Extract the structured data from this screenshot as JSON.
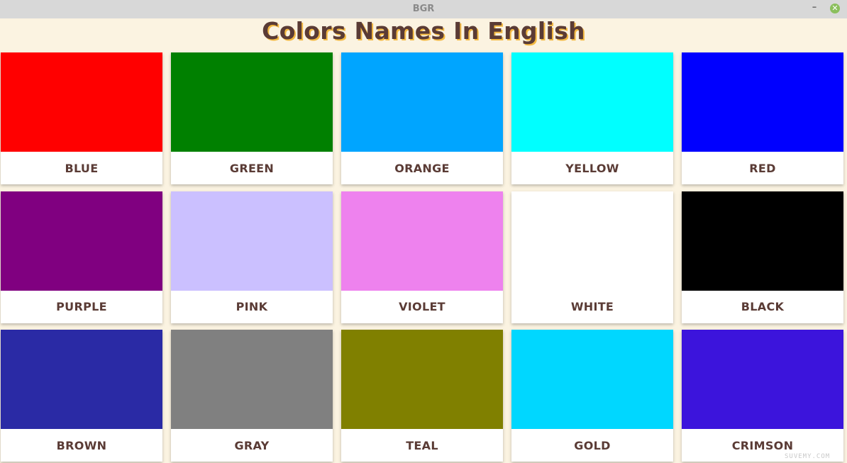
{
  "window": {
    "title": "BGR",
    "minimize_glyph": "–",
    "close_glyph": "✕"
  },
  "page": {
    "heading": "Colors Names In English"
  },
  "colors": [
    {
      "label": "BLUE",
      "swatch": "#ff0000"
    },
    {
      "label": "GREEN",
      "swatch": "#008000"
    },
    {
      "label": "ORANGE",
      "swatch": "#00a5ff"
    },
    {
      "label": "YELLOW",
      "swatch": "#00ffff"
    },
    {
      "label": "RED",
      "swatch": "#0000ff"
    },
    {
      "label": "PURPLE",
      "swatch": "#800080"
    },
    {
      "label": "PINK",
      "swatch": "#cbc0ff"
    },
    {
      "label": "VIOLET",
      "swatch": "#ee82ee"
    },
    {
      "label": "WHITE",
      "swatch": "#ffffff"
    },
    {
      "label": "BLACK",
      "swatch": "#000000"
    },
    {
      "label": "BROWN",
      "swatch": "#2a2aa5"
    },
    {
      "label": "GRAY",
      "swatch": "#808080"
    },
    {
      "label": "TEAL",
      "swatch": "#808000"
    },
    {
      "label": "GOLD",
      "swatch": "#00d7ff"
    },
    {
      "label": "CRIMSON",
      "swatch": "#3c14dc"
    }
  ],
  "watermark": "SUVEMY.COM"
}
